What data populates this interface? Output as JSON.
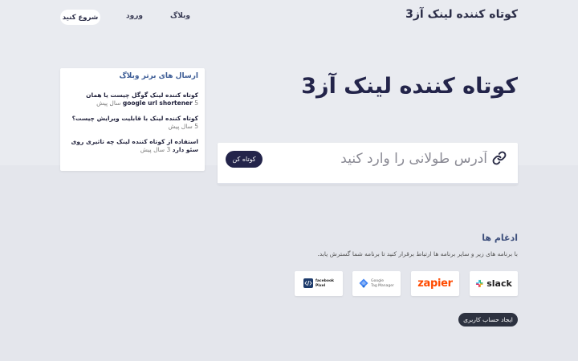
{
  "header": {
    "brand": "کوتاه کننده لینک آز3",
    "nav": {
      "blog": "وبلاگ",
      "login": "ورود",
      "start": "شروع کنید"
    }
  },
  "hero": {
    "title": "کوتاه کننده لینک آز3",
    "input_placeholder": "آدرس طولانی را وارد کنید",
    "shorten_button": "کوتاه کن",
    "link_icon": "link-icon"
  },
  "blog": {
    "heading": "ارسال های برتر وبلاگ",
    "posts": [
      {
        "title": "کوتاه کننده لینک گوگل چیست یا همان google url shortener",
        "time": "5 سال پیش"
      },
      {
        "title": "کوتاه کننده لینک با قابلیت ویرایش چیست؟",
        "time": "5 سال پیش"
      },
      {
        "title": "استفاده از کوتاه کننده لینک چه تاثیری روی سئو دارد",
        "time": "3 سال پیش"
      }
    ]
  },
  "integrations": {
    "title": "ادغام ها",
    "description": "با برنامه های زیر و سایر برنامه ها ارتباط برقرار کنید تا برنامه شما گسترش یابد.",
    "logos": {
      "slack": "slack",
      "zapier": "zapier",
      "gtm_line1": "Google",
      "gtm_line2": "Tag Manager",
      "fb_line1": "facebook",
      "fb_line2": "Pixel"
    },
    "create_account_button": "ایجاد حساب کاربری"
  },
  "colors": {
    "primary_dark": "#23244a",
    "page_bg": "#e4e6ec",
    "zapier_orange": "#ff4a00"
  }
}
